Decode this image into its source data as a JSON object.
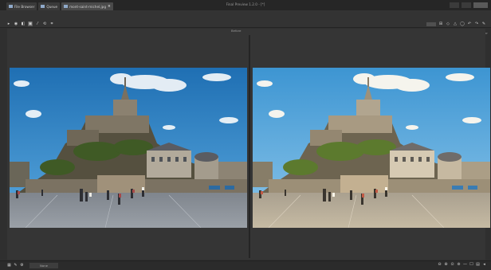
{
  "window": {
    "title": "Final Preview 1.2.0 - [*]",
    "tabs": [
      {
        "label": "File Browser"
      },
      {
        "label": "Queue"
      },
      {
        "label": "mont-saint-michel.jpg",
        "active": true
      }
    ]
  },
  "toolbar": {
    "left_tools": [
      {
        "glyph": "▸",
        "name": "play-icon"
      },
      {
        "glyph": "◉",
        "name": "target-icon"
      },
      {
        "glyph": "◧",
        "name": "split-view-icon"
      },
      {
        "glyph": "▣",
        "name": "compare-icon"
      },
      {
        "glyph": "⁄",
        "name": "straighten-icon"
      },
      {
        "glyph": "⟲",
        "name": "rotate-icon"
      },
      {
        "glyph": "⌗",
        "name": "grid-icon"
      }
    ],
    "right_tools": [
      {
        "glyph": "⊞",
        "name": "layout-icon"
      },
      {
        "glyph": "◇",
        "name": "diamond-icon"
      },
      {
        "glyph": "△",
        "name": "warning-icon"
      },
      {
        "glyph": "◯",
        "name": "circle-icon"
      },
      {
        "glyph": "↶",
        "name": "undo-icon"
      },
      {
        "glyph": "↷",
        "name": "redo-icon"
      },
      {
        "glyph": "✎",
        "name": "edit-icon"
      }
    ],
    "right_caption": "After"
  },
  "viewer": {
    "before_label": "Before"
  },
  "statusbar": {
    "left_icons": [
      {
        "glyph": "▦",
        "name": "thumbnails-icon"
      },
      {
        "glyph": "✎",
        "name": "pencil-icon"
      },
      {
        "glyph": "⚙",
        "name": "settings-icon"
      }
    ],
    "field_value": "None",
    "right_icons": [
      {
        "glyph": "⊖",
        "name": "zoom-out-icon"
      },
      {
        "glyph": "⊕",
        "name": "zoom-in-icon"
      },
      {
        "glyph": "⊙",
        "name": "zoom-fit-icon"
      },
      {
        "glyph": "⊚",
        "name": "zoom-100-icon"
      },
      {
        "glyph": "—",
        "name": "minus-icon"
      },
      {
        "glyph": "☐",
        "name": "window-icon"
      },
      {
        "glyph": "▤",
        "name": "panel-icon"
      },
      {
        "glyph": "◂",
        "name": "collapse-icon"
      }
    ]
  },
  "colors": {
    "before_sky": "#2f86c6",
    "after_sky": "#4aa3db",
    "before_ground": "#8a8f96",
    "after_ground": "#b7aa95"
  }
}
